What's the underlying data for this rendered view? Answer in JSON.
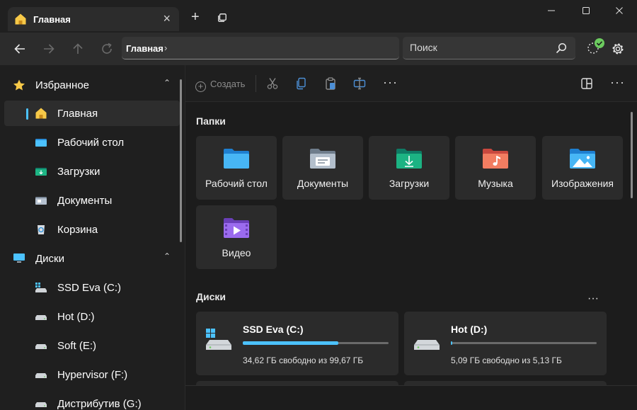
{
  "tab": {
    "title": "Главная"
  },
  "address": {
    "crumb": "Главная",
    "separator": "›"
  },
  "search": {
    "placeholder": "Поиск"
  },
  "sidebar": {
    "favorites": {
      "label": "Избранное"
    },
    "items": [
      {
        "label": "Главная"
      },
      {
        "label": "Рабочий стол"
      },
      {
        "label": "Загрузки"
      },
      {
        "label": "Документы"
      },
      {
        "label": "Корзина"
      }
    ],
    "drives": {
      "label": "Диски"
    },
    "drive_items": [
      {
        "label": "SSD Eva (C:)"
      },
      {
        "label": "Hot (D:)"
      },
      {
        "label": "Soft (E:)"
      },
      {
        "label": "Hypervisor (F:)"
      },
      {
        "label": "Дистрибутив (G:)"
      }
    ]
  },
  "toolbar": {
    "create_label": "Создать"
  },
  "folders": {
    "title": "Папки",
    "items": [
      {
        "label": "Рабочий стол",
        "icon": "desktop-folder-icon"
      },
      {
        "label": "Документы",
        "icon": "documents-folder-icon"
      },
      {
        "label": "Загрузки",
        "icon": "downloads-folder-icon"
      },
      {
        "label": "Музыка",
        "icon": "music-folder-icon"
      },
      {
        "label": "Изображения",
        "icon": "pictures-folder-icon"
      },
      {
        "label": "Видео",
        "icon": "videos-folder-icon"
      }
    ]
  },
  "drives": {
    "title": "Диски",
    "items": [
      {
        "name": "SSD Eva (C:)",
        "free": "34,62 ГБ свободно из 99,67 ГБ",
        "used_fraction": 0.653
      },
      {
        "name": "Hot (D:)",
        "free": "5,09 ГБ свободно из 5,13 ГБ",
        "used_fraction": 0.008
      }
    ]
  },
  "colors": {
    "accent": "#4cc2ff",
    "folder": "#f7c948"
  }
}
